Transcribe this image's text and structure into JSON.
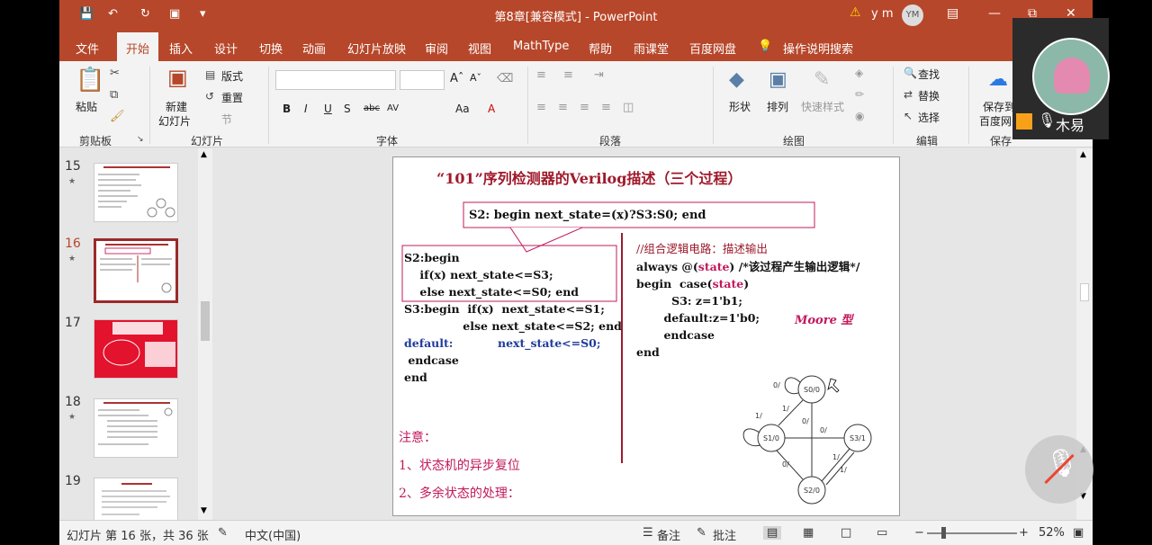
{
  "window": {
    "title": "第8章[兼容模式] - PowerPoint",
    "user": "y m",
    "user_initials": "YM"
  },
  "tabs": [
    "文件",
    "开始",
    "插入",
    "设计",
    "切换",
    "动画",
    "幻灯片放映",
    "审阅",
    "视图",
    "MathType",
    "帮助",
    "雨课堂",
    "百度网盘",
    "操作说明搜索"
  ],
  "ribbon": {
    "paste": "粘贴",
    "clipboard_group": "剪贴板",
    "new_slide_1": "新建",
    "new_slide_2": "幻灯片",
    "layout": "版式",
    "reset": "重置",
    "section": "节",
    "slides_group": "幻灯片",
    "font_group": "字体",
    "paragraph_group": "段落",
    "shape": "形状",
    "arrange": "排列",
    "quick_styles": "快速样式",
    "drawing_group": "绘图",
    "find": "查找",
    "replace": "替换",
    "select": "选择",
    "editing_group": "编辑",
    "save_1": "保存到",
    "save_2": "百度网",
    "save_group": "保存",
    "font_buttons": [
      "B",
      "I",
      "U",
      "S",
      "abc",
      "AV",
      "Aa",
      "A"
    ]
  },
  "thumbnails": [
    {
      "num": "15"
    },
    {
      "num": "16"
    },
    {
      "num": "17"
    },
    {
      "num": "18"
    },
    {
      "num": "19"
    }
  ],
  "slide": {
    "title": "“101”序列检测器的Verilog描述（三个过程）",
    "callout": "S2: begin next_state=(x)?S3:S0; end",
    "left_code_1": "S2:begin\n    if(x) next_state<=S3;\n    else next_state<=S0; end",
    "left_code_2": "S3:begin  if(x)  next_state<=S1;\n               else next_state<=S2; end",
    "default_kw": "default:",
    "default_val": "next_state<=S0;",
    "left_code_3": " endcase\nend",
    "comment": "//组合逻辑电路：描述输出",
    "always_1": "always @(",
    "always_state": "state",
    "always_2": ") /*该过程产生输出逻辑*/",
    "begin_case_1": "begin  case(",
    "begin_case_state": "state",
    "begin_case_2": ")",
    "right_code": "         S3: z=1'b1;\n       default:z=1'b0;\n       endcase\nend",
    "moore": "Moore 型",
    "note_title": "注意：",
    "note_1": "1、状态机的异步复位",
    "note_2": "2、多余状态的处理：",
    "states": [
      "S0/0",
      "S1/0",
      "S2/0",
      "S3/1"
    ],
    "edge_labels": [
      "0/",
      "1/",
      "1/",
      "0/",
      "0/",
      "1/",
      "0/",
      "1/"
    ]
  },
  "status": {
    "slide_info": "幻灯片 第 16 张，共 36 张",
    "language": "中文(中国)",
    "notes": "备注",
    "comments": "批注",
    "zoom": "52%"
  },
  "overlay": {
    "name": "木易"
  },
  "colors": {
    "accent": "#b7472a",
    "slide_title": "#a0192b",
    "keyword_blue": "#1f3b9b",
    "state_red": "#c2185b",
    "divider": "#9b1b2c"
  }
}
